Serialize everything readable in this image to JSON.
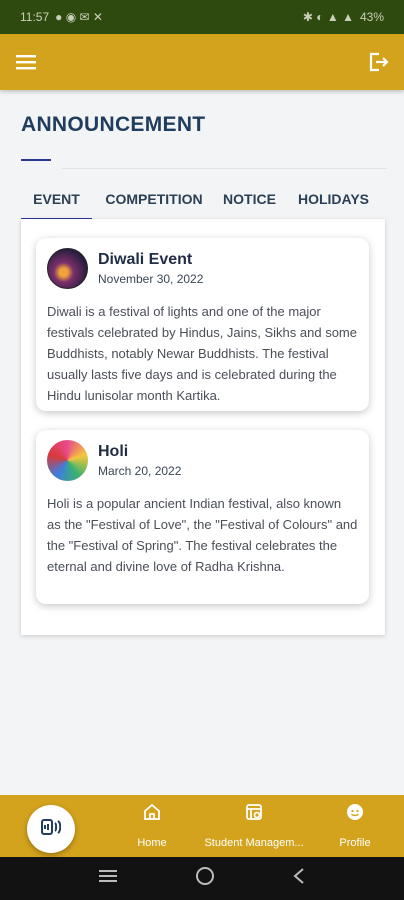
{
  "colors": {
    "accent": "#d4a31d",
    "status_bar": "#2f4a0f",
    "title": "#1f3d5e",
    "tab_indicator": "#2a3a8c",
    "system_nav": "#121212"
  },
  "status_bar": {
    "time": "11:57",
    "battery": "43%"
  },
  "app_bar": {
    "menu_icon": "hamburger-menu-icon",
    "logout_icon": "logout-icon"
  },
  "page": {
    "title": "ANNOUNCEMENT"
  },
  "tabs": [
    {
      "label": "EVENT",
      "active": true
    },
    {
      "label": "COMPETITION",
      "active": false
    },
    {
      "label": "NOTICE",
      "active": false
    },
    {
      "label": "HOLIDAYS",
      "active": false
    }
  ],
  "announcements": [
    {
      "title": "Diwali Event",
      "date": "November 30, 2022",
      "body": "Diwali is a festival of lights and one of the major festivals celebrated by Hindus, Jains, Sikhs and some Buddhists, notably Newar Buddhists. The festival usually lasts five days and is celebrated during the Hindu lunisolar month Kartika."
    },
    {
      "title": "Holi",
      "date": "March 20, 2022",
      "body": "Holi is a popular ancient Indian festival, also known as the \"Festival of Love\", the \"Festival of Colours\" and the \"Festival of Spring\". The festival celebrates the eternal and divine love of Radha Krishna."
    }
  ],
  "bottom_nav": {
    "fab_icon": "attendance-icon",
    "items": [
      {
        "label": "Home",
        "icon": "home-icon"
      },
      {
        "label": "Student Managem...",
        "icon": "student-management-icon"
      },
      {
        "label": "Profile",
        "icon": "profile-icon"
      }
    ]
  },
  "system_nav": {
    "recents": "recents-icon",
    "home": "home-circle-icon",
    "back": "back-icon"
  }
}
